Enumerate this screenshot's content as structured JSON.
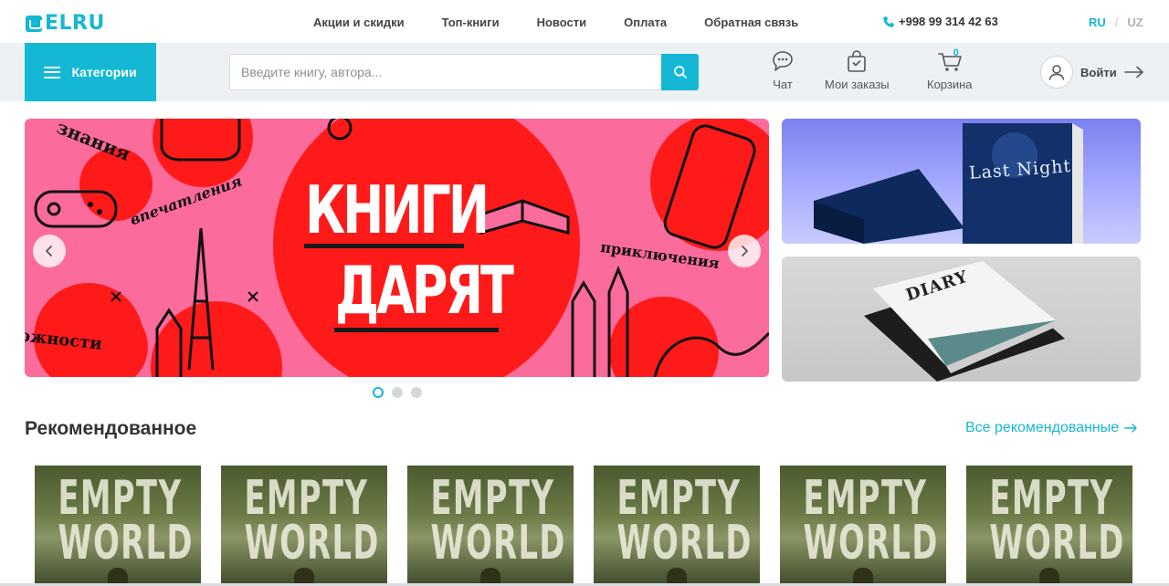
{
  "brand": {
    "name": "ELRU"
  },
  "topnav": {
    "items": [
      "Акции и скидки",
      "Топ-книги",
      "Новости",
      "Оплата",
      "Обратная связь"
    ]
  },
  "contact": {
    "phone": "+998 99 314 42 63"
  },
  "languages": {
    "active": "RU",
    "separator": "/",
    "other": "UZ"
  },
  "header": {
    "categories_label": "Категории",
    "search_placeholder": "Введите книгу, автора...",
    "chat_label": "Чат",
    "orders_label": "Мои заказы",
    "cart_label": "Корзина",
    "cart_count": "0",
    "login_label": "Войти"
  },
  "banner": {
    "line1": "КНИГИ",
    "line2": "ДАРЯТ",
    "words": [
      "знания",
      "впечатления",
      "приключения",
      "ожности"
    ],
    "slides_total": 3,
    "active_slide": 1
  },
  "side_banners": [
    {
      "title": "Last Night"
    },
    {
      "title": "DIARY"
    }
  ],
  "recommended": {
    "title": "Рекомендованное",
    "all_link": "Все рекомендованные",
    "books": [
      {
        "line1": "EMPTY",
        "line2": "WORLD"
      },
      {
        "line1": "EMPTY",
        "line2": "WORLD"
      },
      {
        "line1": "EMPTY",
        "line2": "WORLD"
      },
      {
        "line1": "EMPTY",
        "line2": "WORLD"
      },
      {
        "line1": "EMPTY",
        "line2": "WORLD"
      },
      {
        "line1": "EMPTY",
        "line2": "WORLD"
      }
    ]
  },
  "colors": {
    "accent": "#14b8d4",
    "banner_pink": "#fb6b9b",
    "banner_red": "#ff1a1a"
  }
}
